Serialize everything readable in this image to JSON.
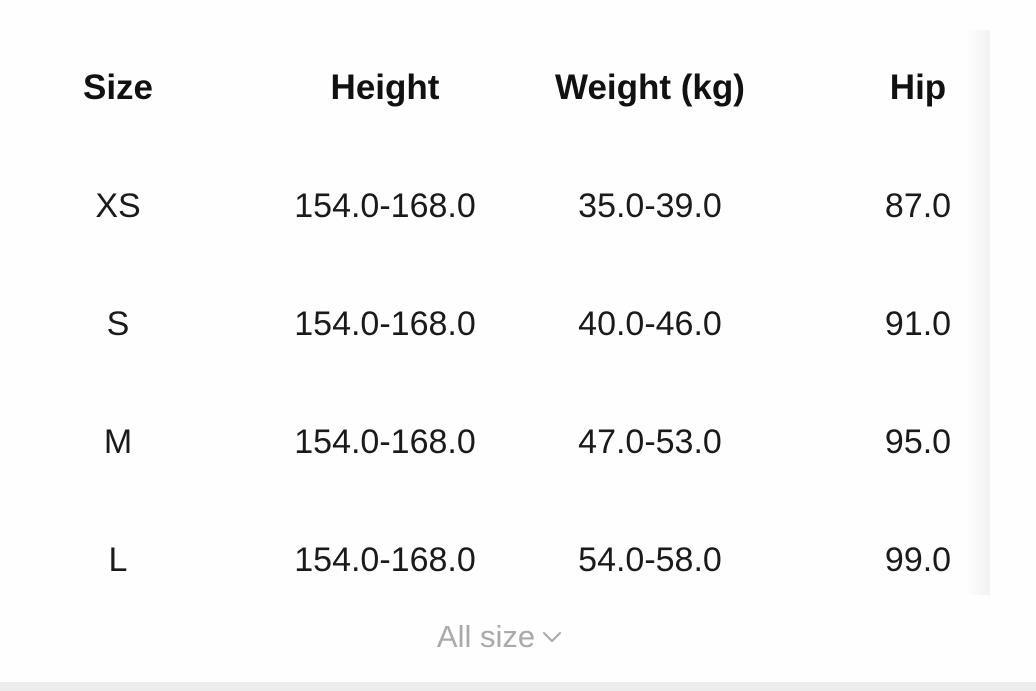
{
  "table": {
    "headers": {
      "size": "Size",
      "height": "Height",
      "weight": "Weight (kg)",
      "hip": "Hip"
    },
    "rows": [
      {
        "size": "XS",
        "height": "154.0-168.0",
        "weight": "35.0-39.0",
        "hip": "87.0"
      },
      {
        "size": "S",
        "height": "154.0-168.0",
        "weight": "40.0-46.0",
        "hip": "91.0"
      },
      {
        "size": "M",
        "height": "154.0-168.0",
        "weight": "47.0-53.0",
        "hip": "95.0"
      },
      {
        "size": "L",
        "height": "154.0-168.0",
        "weight": "54.0-58.0",
        "hip": "99.0"
      }
    ]
  },
  "expand": {
    "label": "All size",
    "icon": "chevron-down-icon"
  }
}
